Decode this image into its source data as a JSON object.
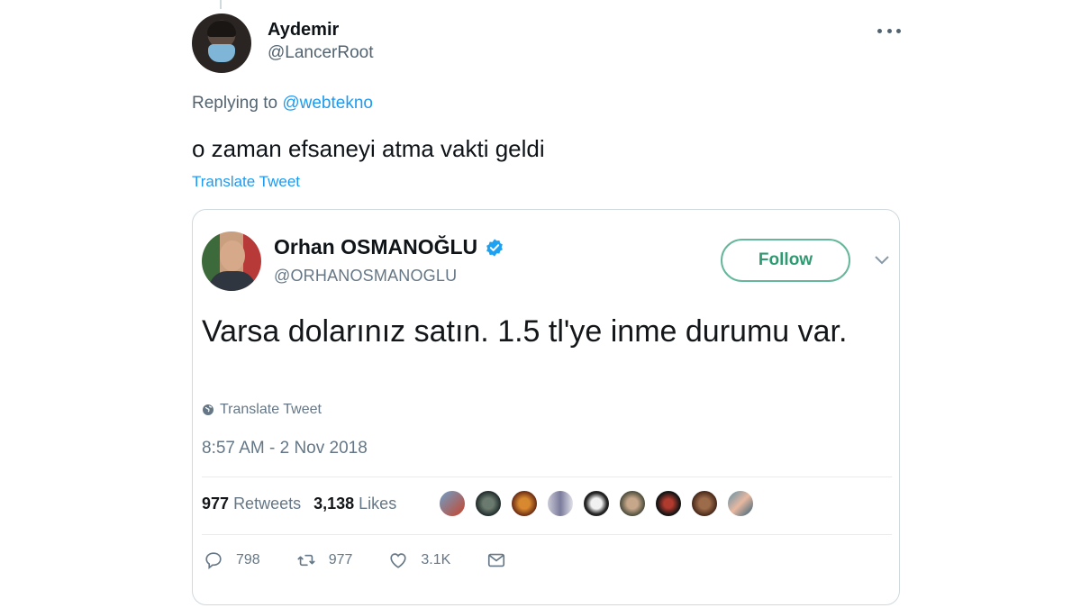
{
  "outer_tweet": {
    "name": "Aydemir",
    "handle": "@LancerRoot",
    "replying_prefix": "Replying to",
    "replying_mention": "@webtekno",
    "text": "o zaman efsaneyi atma vakti geldi",
    "translate_label": "Translate Tweet"
  },
  "quoted_tweet": {
    "name": "Orhan OSMANOĞLU",
    "handle": "@ORHANOSMANOGLU",
    "follow_label": "Follow",
    "text": "Varsa dolarınız satın. 1.5 tl'ye inme durumu var.",
    "translate_label": "Translate Tweet",
    "timestamp": "8:57 AM - 2 Nov 2018",
    "retweets_count": "977",
    "retweets_label": "Retweets",
    "likes_count": "3,138",
    "likes_label": "Likes",
    "actions": {
      "replies": "798",
      "retweets": "977",
      "likes": "3.1K"
    }
  },
  "colors": {
    "link": "#1d9bf0",
    "follow_border": "#66b79a",
    "verified": "#1da1f2",
    "secondary_text": "#536471"
  }
}
